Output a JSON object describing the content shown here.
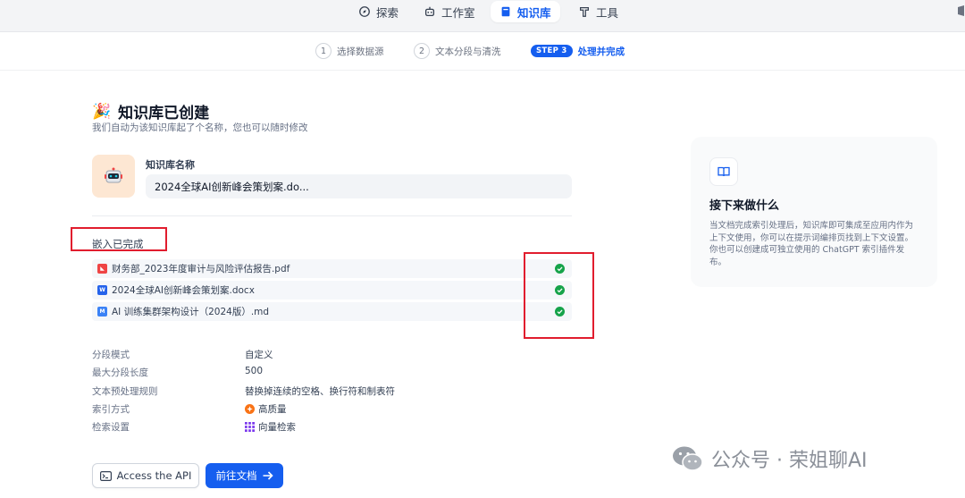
{
  "nav": {
    "items": [
      {
        "label": "探索",
        "icon": "compass-icon"
      },
      {
        "label": "工作室",
        "icon": "robot-icon"
      },
      {
        "label": "知识库",
        "icon": "book-icon",
        "active": true
      },
      {
        "label": "工具",
        "icon": "hammer-icon"
      }
    ]
  },
  "steps": [
    {
      "num": "1",
      "label": "选择数据源"
    },
    {
      "num": "2",
      "label": "文本分段与清洗"
    },
    {
      "pill": "STEP 3",
      "label": "处理并完成"
    }
  ],
  "page": {
    "emoji": "🎉",
    "title": "知识库已创建",
    "subtitle": "我们自动为该知识库起了个名称，您也可以随时修改"
  },
  "knowledge_base": {
    "name_label": "知识库名称",
    "name_value": "2024全球AI创新峰会策划案.do..."
  },
  "embedding": {
    "title": "嵌入已完成",
    "files": [
      {
        "name": "财务部_2023年度审计与风险评估报告.pdf",
        "type": "pdf",
        "status": "done"
      },
      {
        "name": "2024全球AI创新峰会策划案.docx",
        "type": "docx",
        "status": "done"
      },
      {
        "name": "AI 训练集群架构设计（2024版）.md",
        "type": "md",
        "status": "done"
      }
    ]
  },
  "settings": [
    {
      "key": "分段模式",
      "value": "自定义"
    },
    {
      "key": "最大分段长度",
      "value": "500"
    },
    {
      "key": "文本预处理规则",
      "value": "替换掉连续的空格、换行符和制表符"
    },
    {
      "key": "索引方式",
      "value": "高质量",
      "icon": "quality-icon"
    },
    {
      "key": "检索设置",
      "value": "向量检索",
      "icon": "vector-grid-icon"
    }
  ],
  "buttons": {
    "api_label": "Access the API",
    "docs_label": "前往文档"
  },
  "next_panel": {
    "title": "接下来做什么",
    "desc": "当文档完成索引处理后，知识库即可集成至应用内作为上下文使用，你可以在提示词编排页找到上下文设置。你也可以创建成可独立使用的 ChatGPT 索引插件发布。"
  },
  "watermark": "公众号 · 荣姐聊AI",
  "colors": {
    "accent": "#155eef",
    "success": "#16a34a",
    "annotation": "#e11d2e"
  }
}
